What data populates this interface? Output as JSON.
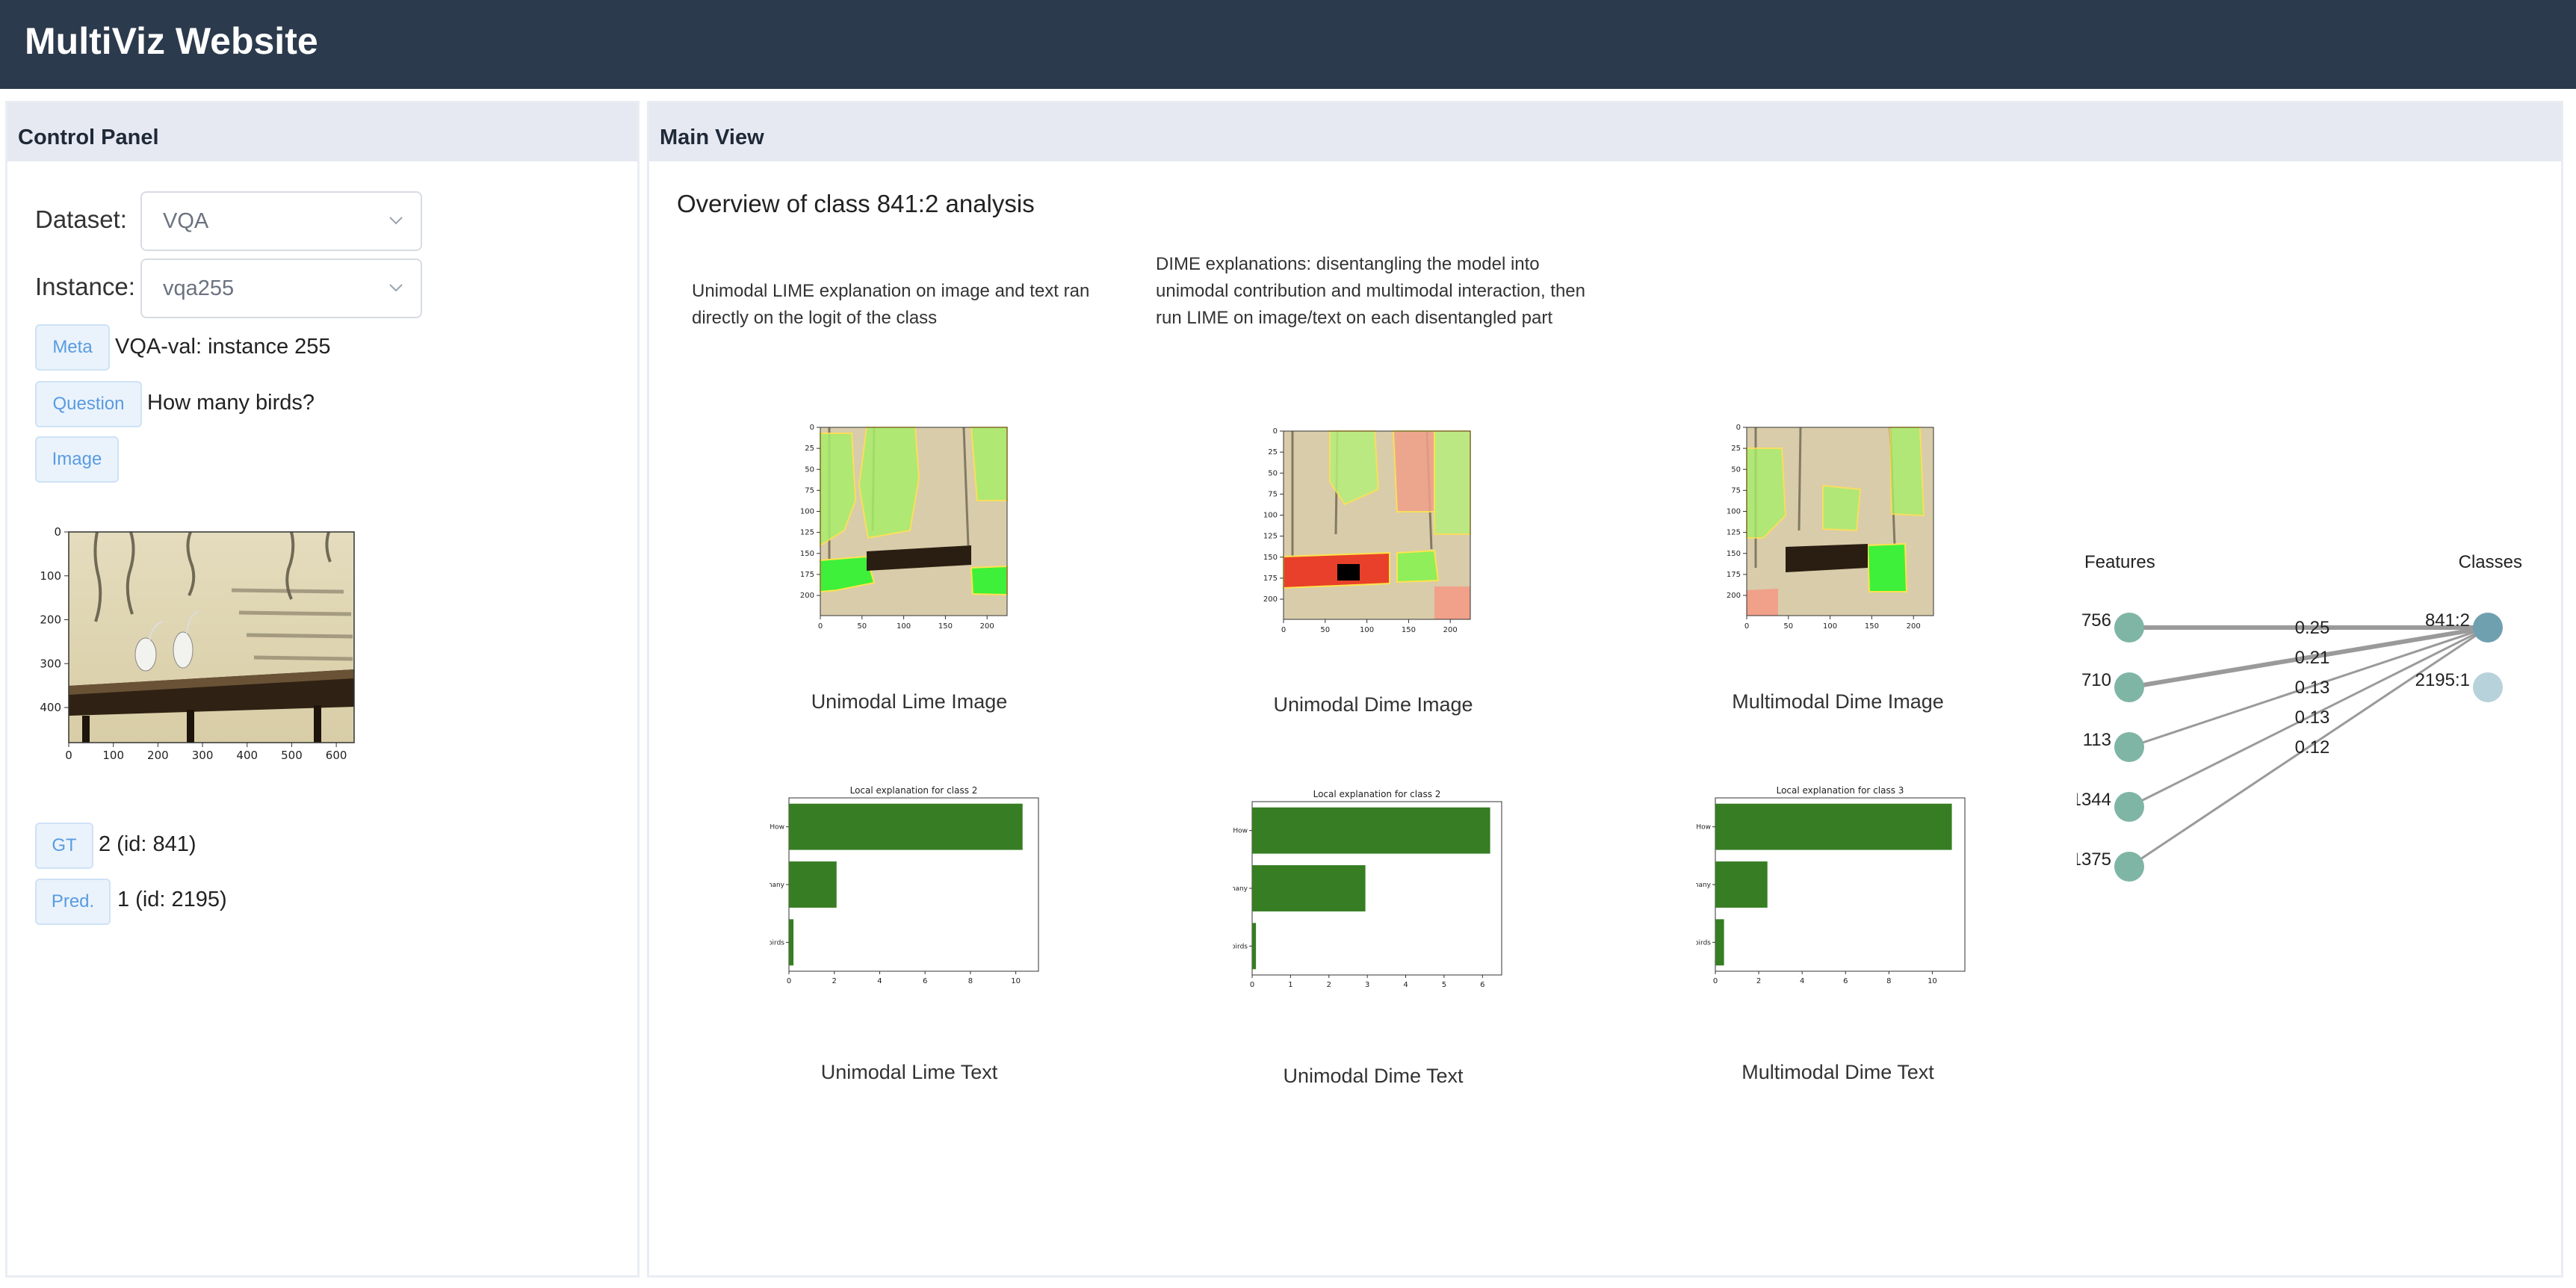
{
  "app": {
    "title": "MultiViz Website"
  },
  "control_panel": {
    "title": "Control Panel",
    "dataset": {
      "label": "Dataset:",
      "value": "VQA"
    },
    "instance": {
      "label": "Instance:",
      "value": "vqa255"
    },
    "meta": {
      "tag": "Meta",
      "value": "VQA-val: instance 255"
    },
    "question": {
      "tag": "Question",
      "value": "How many birds?"
    },
    "image": {
      "tag": "Image",
      "x_ticks": [
        "0",
        "100",
        "200",
        "300",
        "400",
        "500",
        "600"
      ],
      "y_ticks": [
        "0",
        "100",
        "200",
        "300",
        "400"
      ]
    },
    "gt": {
      "tag": "GT",
      "value": "2 (id: 841)"
    },
    "pred": {
      "tag": "Pred.",
      "value": "1 (id: 2195)"
    }
  },
  "main_view": {
    "title": "Main View",
    "heading": "Overview of class 841:2 analysis",
    "lime_description": "Unimodal LIME explanation on image and text ran directly on the logit of the class",
    "dime_description": "DIME explanations: disentangling the model into unimodal contribution and multimodal interaction, then run LIME on image/text on each disentangled part",
    "heatmap_axes": {
      "x_ticks": [
        "0",
        "50",
        "100",
        "150",
        "200"
      ],
      "y_ticks": [
        "0",
        "25",
        "50",
        "75",
        "100",
        "125",
        "150",
        "175",
        "200"
      ]
    },
    "captions": {
      "unimodal_lime_image": "Unimodal Lime Image",
      "unimodal_dime_image": "Unimodal Dime Image",
      "multimodal_dime_image": "Multimodal Dime Image",
      "unimodal_lime_text": "Unimodal Lime Text",
      "unimodal_dime_text": "Unimodal Dime Text",
      "multimodal_dime_text": "Multimodal Dime Text"
    },
    "graph": {
      "features_label": "Features",
      "classes_label": "Classes",
      "features": [
        "756",
        "710",
        "113",
        "1344",
        "1375"
      ],
      "classes": [
        "841:2",
        "2195:1"
      ],
      "edge_weights": [
        "0.25",
        "0.21",
        "0.13",
        "0.13",
        "0.12"
      ]
    }
  },
  "chart_data": [
    {
      "type": "bar",
      "orientation": "horizontal",
      "title": "Local explanation for class 2",
      "categories": [
        "How",
        "many",
        "birds"
      ],
      "values": [
        10.3,
        2.1,
        0.2
      ],
      "xlim": [
        0,
        11
      ],
      "x_ticks": [
        "0",
        "2",
        "4",
        "6",
        "8",
        "10"
      ],
      "bar_color": "#367d23"
    },
    {
      "type": "bar",
      "orientation": "horizontal",
      "title": "Local explanation for class 2",
      "categories": [
        "How",
        "many",
        "birds"
      ],
      "values": [
        6.2,
        2.95,
        0.1
      ],
      "xlim": [
        0,
        6.5
      ],
      "x_ticks": [
        "0",
        "1",
        "2",
        "3",
        "4",
        "5",
        "6"
      ],
      "bar_color": "#367d23"
    },
    {
      "type": "bar",
      "orientation": "horizontal",
      "title": "Local explanation for class 3",
      "categories": [
        "How",
        "many",
        "birds"
      ],
      "values": [
        10.9,
        2.4,
        0.4
      ],
      "xlim": [
        0,
        11.5
      ],
      "x_ticks": [
        "0",
        "2",
        "4",
        "6",
        "8",
        "10"
      ],
      "bar_color": "#367d23"
    }
  ]
}
